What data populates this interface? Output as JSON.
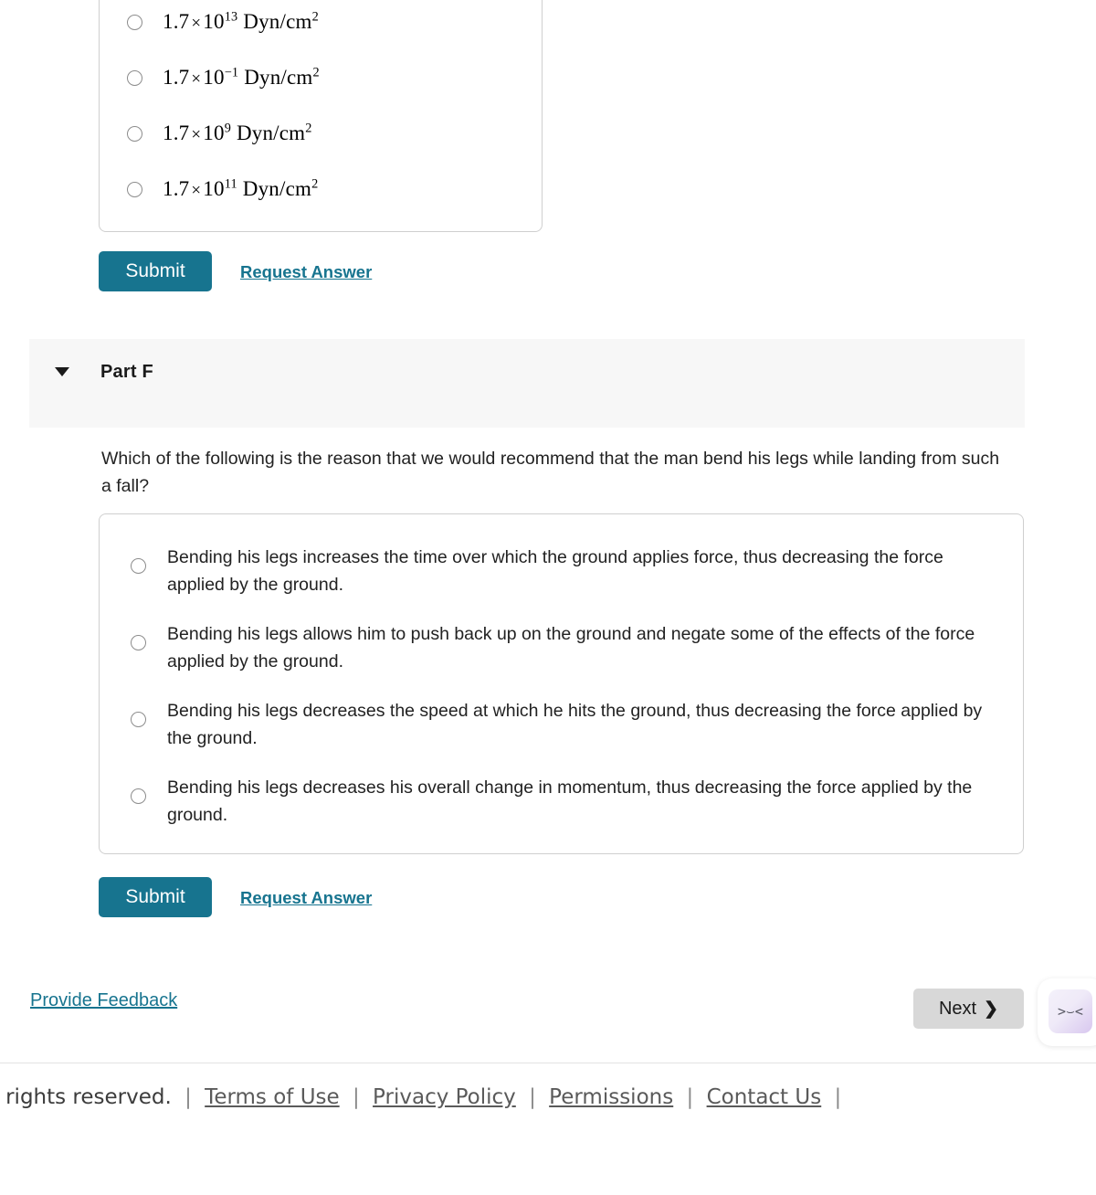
{
  "part_e": {
    "options": [
      {
        "mantissa": "1.7",
        "times": "×",
        "base": "10",
        "exponent": "13",
        "unit": "Dyn/cm",
        "unit_exp": "2"
      },
      {
        "mantissa": "1.7",
        "times": "×",
        "base": "10",
        "exponent": "−1",
        "unit": "Dyn/cm",
        "unit_exp": "2"
      },
      {
        "mantissa": "1.7",
        "times": "×",
        "base": "10",
        "exponent": "9",
        "unit": "Dyn/cm",
        "unit_exp": "2"
      },
      {
        "mantissa": "1.7",
        "times": "×",
        "base": "10",
        "exponent": "11",
        "unit": "Dyn/cm",
        "unit_exp": "2"
      }
    ],
    "submit_label": "Submit",
    "request_answer_label": "Request Answer"
  },
  "part_f": {
    "title": "Part F",
    "question": "Which of the following is the reason that we would recommend that the man bend his legs while landing from such a fall?",
    "options": [
      "Bending his legs increases the time over which the ground applies force, thus decreasing the force applied by the ground.",
      "Bending his legs allows him to push back up on the ground and negate some of the effects of the force applied by the ground.",
      "Bending his legs decreases the speed at which he hits the ground, thus decreasing the force applied by the ground.",
      "Bending his legs decreases his overall change in momentum, thus decreasing the force applied by the ground."
    ],
    "submit_label": "Submit",
    "request_answer_label": "Request Answer"
  },
  "actions": {
    "provide_feedback_label": "Provide Feedback",
    "next_label": "Next",
    "next_chevron": "❯",
    "face_widget_label": ">⌣<"
  },
  "footer": {
    "copyright": "ll rights reserved.",
    "separator": "|",
    "links": [
      "Terms of Use",
      "Privacy Policy",
      "Permissions",
      "Contact Us"
    ]
  },
  "colors": {
    "accent_teal": "#17748f",
    "band_grey": "#f7f7f7",
    "next_grey": "#d8d8d8"
  }
}
